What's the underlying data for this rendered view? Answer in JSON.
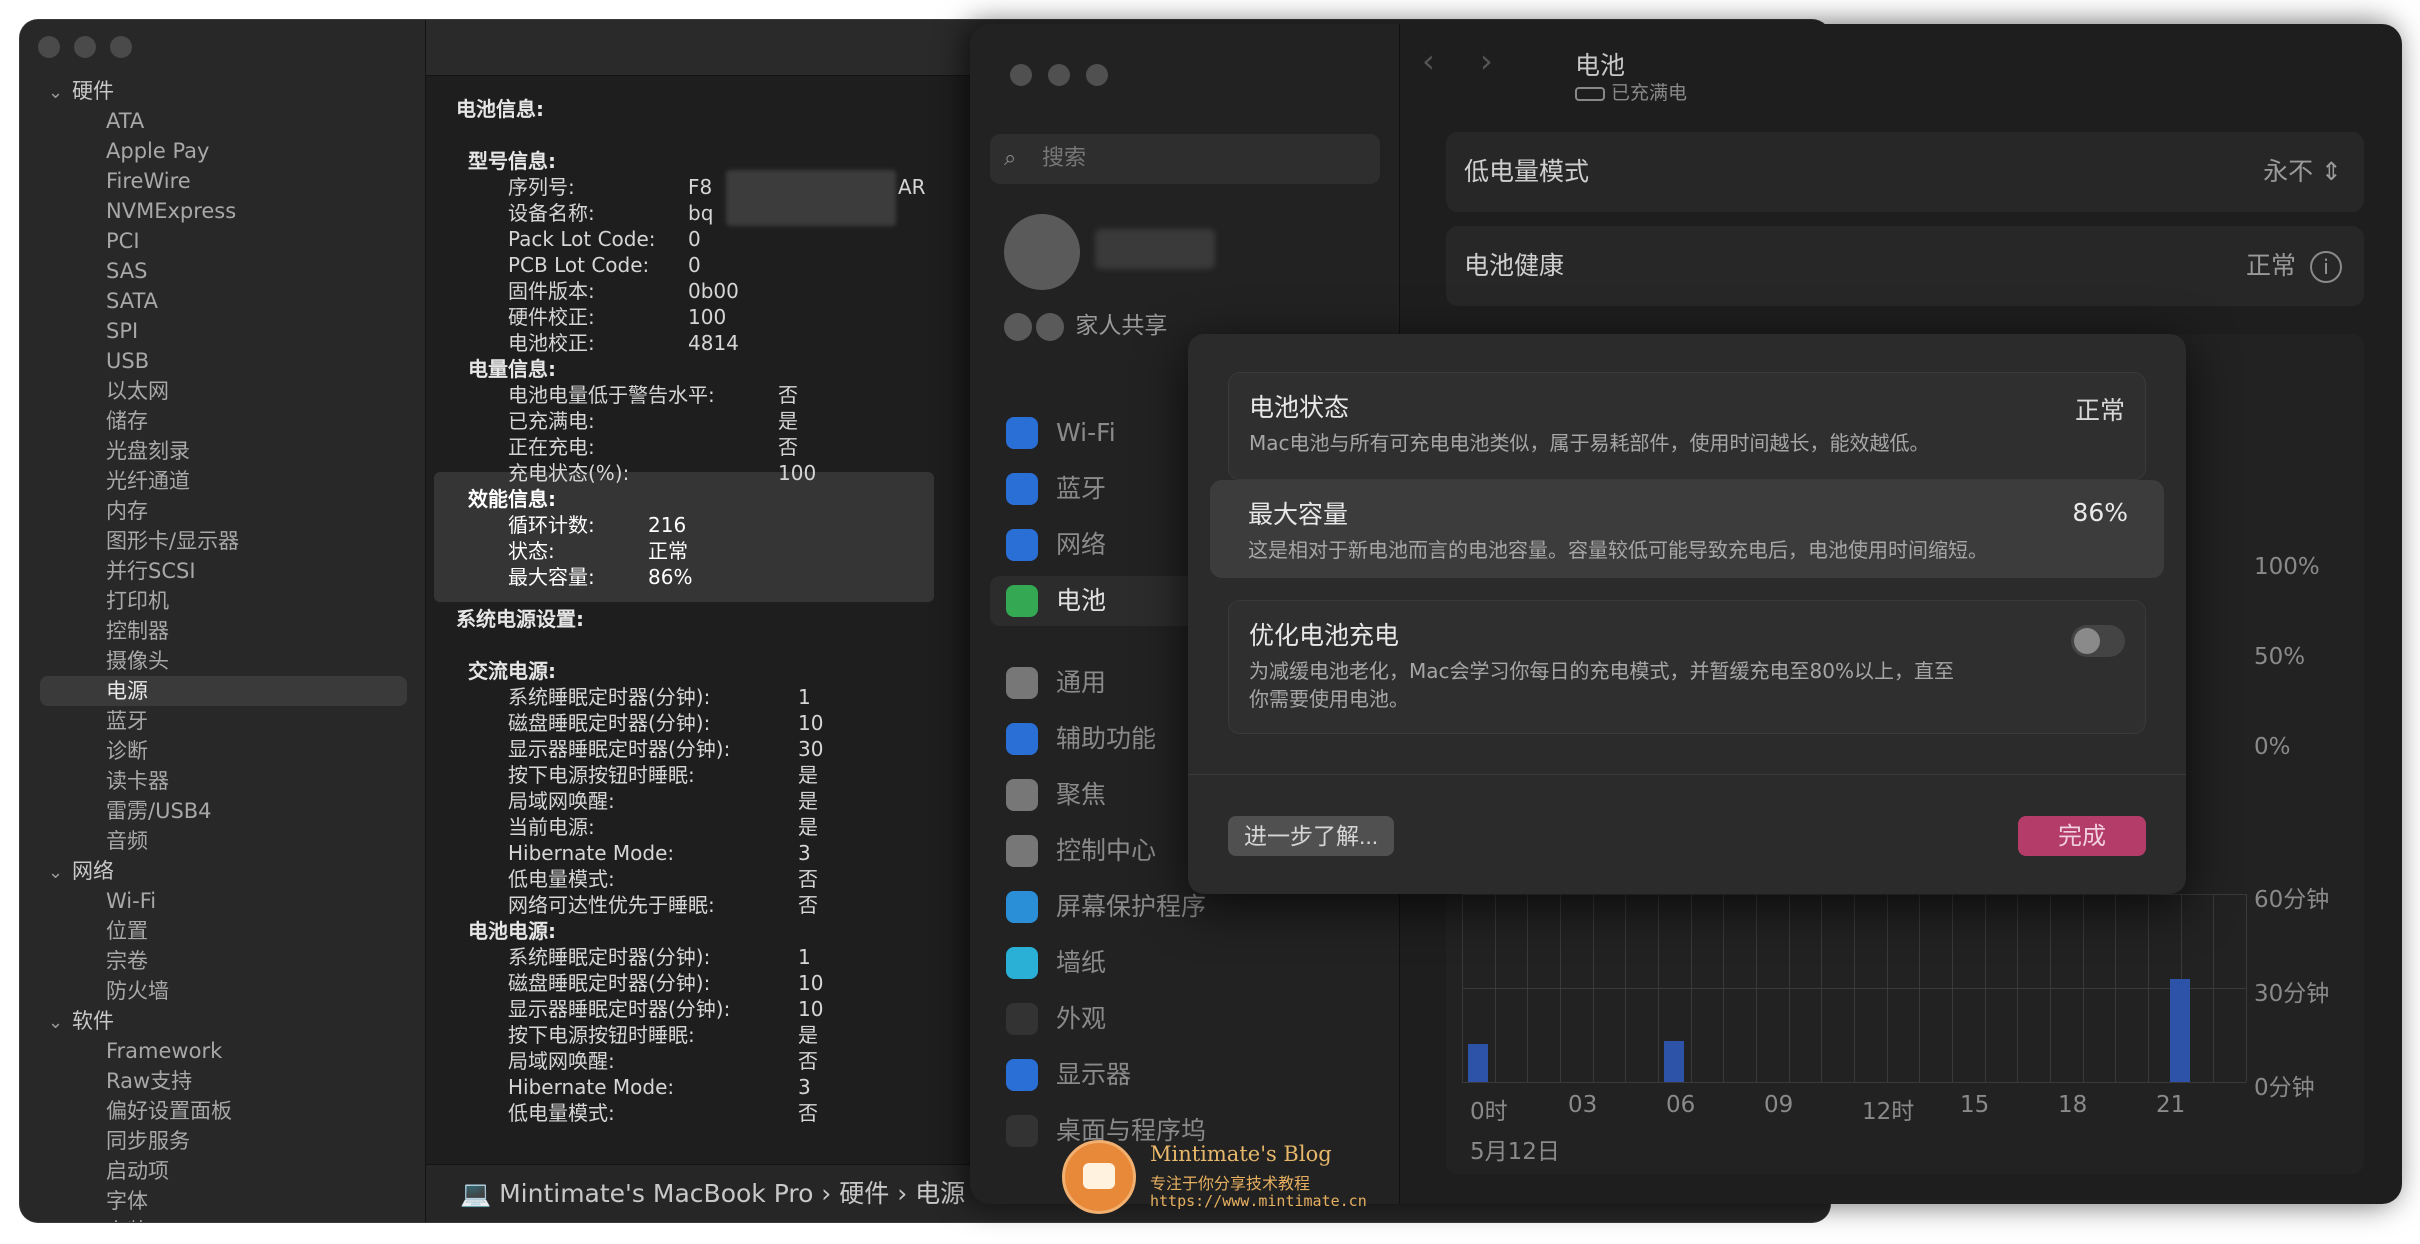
{
  "sysinfo": {
    "sidebar": [
      {
        "type": "section",
        "label": "硬件"
      },
      {
        "type": "item",
        "label": "ATA"
      },
      {
        "type": "item",
        "label": "Apple Pay"
      },
      {
        "type": "item",
        "label": "FireWire"
      },
      {
        "type": "item",
        "label": "NVMExpress"
      },
      {
        "type": "item",
        "label": "PCI"
      },
      {
        "type": "item",
        "label": "SAS"
      },
      {
        "type": "item",
        "label": "SATA"
      },
      {
        "type": "item",
        "label": "SPI"
      },
      {
        "type": "item",
        "label": "USB"
      },
      {
        "type": "item",
        "label": "以太网"
      },
      {
        "type": "item",
        "label": "储存"
      },
      {
        "type": "item",
        "label": "光盘刻录"
      },
      {
        "type": "item",
        "label": "光纤通道"
      },
      {
        "type": "item",
        "label": "内存"
      },
      {
        "type": "item",
        "label": "图形卡/显示器"
      },
      {
        "type": "item",
        "label": "并行SCSI"
      },
      {
        "type": "item",
        "label": "打印机"
      },
      {
        "type": "item",
        "label": "控制器"
      },
      {
        "type": "item",
        "label": "摄像头"
      },
      {
        "type": "item",
        "label": "电源",
        "selected": true
      },
      {
        "type": "item",
        "label": "蓝牙"
      },
      {
        "type": "item",
        "label": "诊断"
      },
      {
        "type": "item",
        "label": "读卡器"
      },
      {
        "type": "item",
        "label": "雷雳/USB4"
      },
      {
        "type": "item",
        "label": "音频"
      },
      {
        "type": "section",
        "label": "网络"
      },
      {
        "type": "item",
        "label": "Wi-Fi"
      },
      {
        "type": "item",
        "label": "位置"
      },
      {
        "type": "item",
        "label": "宗卷"
      },
      {
        "type": "item",
        "label": "防火墙"
      },
      {
        "type": "section",
        "label": "软件"
      },
      {
        "type": "item",
        "label": "Framework"
      },
      {
        "type": "item",
        "label": "Raw支持"
      },
      {
        "type": "item",
        "label": "偏好设置面板"
      },
      {
        "type": "item",
        "label": "同步服务"
      },
      {
        "type": "item",
        "label": "启动项"
      },
      {
        "type": "item",
        "label": "字体"
      },
      {
        "type": "item",
        "label": "安装"
      }
    ],
    "detail": {
      "battery_title": "电池信息:",
      "model_hdr": "型号信息:",
      "model": [
        {
          "k": "序列号:",
          "v": "F8",
          "v2": "AR"
        },
        {
          "k": "设备名称:",
          "v": "bq"
        },
        {
          "k": "Pack Lot Code:",
          "v": "0"
        },
        {
          "k": "PCB Lot Code:",
          "v": "0"
        },
        {
          "k": "固件版本:",
          "v": "0b00"
        },
        {
          "k": "硬件校正:",
          "v": "100"
        },
        {
          "k": "电池校正:",
          "v": "4814"
        }
      ],
      "charge_hdr": "电量信息:",
      "charge": [
        {
          "k": "电池电量低于警告水平:",
          "v": "否"
        },
        {
          "k": "已充满电:",
          "v": "是"
        },
        {
          "k": "正在充电:",
          "v": "否"
        },
        {
          "k": "充电状态(%):",
          "v": "100"
        }
      ],
      "perf_hdr": "效能信息:",
      "perf": [
        {
          "k": "循环计数:",
          "v": "216"
        },
        {
          "k": "状态:",
          "v": "正常"
        },
        {
          "k": "最大容量:",
          "v": "86%"
        }
      ],
      "power_title": "系统电源设置:",
      "ac_hdr": "交流电源:",
      "ac": [
        {
          "k": "系统睡眠定时器(分钟):",
          "v": "1"
        },
        {
          "k": "磁盘睡眠定时器(分钟):",
          "v": "10"
        },
        {
          "k": "显示器睡眠定时器(分钟):",
          "v": "30"
        },
        {
          "k": "按下电源按钮时睡眠:",
          "v": "是"
        },
        {
          "k": "局域网唤醒:",
          "v": "是"
        },
        {
          "k": "当前电源:",
          "v": "是"
        },
        {
          "k": "Hibernate Mode:",
          "v": "3"
        },
        {
          "k": "低电量模式:",
          "v": "否"
        },
        {
          "k": "网络可达性优先于睡眠:",
          "v": "否"
        }
      ],
      "batt_hdr": "电池电源:",
      "batt": [
        {
          "k": "系统睡眠定时器(分钟):",
          "v": "1"
        },
        {
          "k": "磁盘睡眠定时器(分钟):",
          "v": "10"
        },
        {
          "k": "显示器睡眠定时器(分钟):",
          "v": "10"
        },
        {
          "k": "按下电源按钮时睡眠:",
          "v": "是"
        },
        {
          "k": "局域网唤醒:",
          "v": "否"
        },
        {
          "k": "Hibernate Mode:",
          "v": "3"
        },
        {
          "k": "低电量模式:",
          "v": "否"
        }
      ]
    },
    "path": "Mintimate's MacBook Pro  ›  硬件  ›  电源"
  },
  "settings": {
    "search_placeholder": "搜索",
    "family": "家人共享",
    "nav": [
      "Wi-Fi",
      "蓝牙",
      "网络",
      "电池",
      "通用",
      "辅助功能",
      "聚焦",
      "控制中心",
      "屏幕保护程序",
      "墙纸",
      "外观",
      "显示器",
      "桌面与程序坞"
    ],
    "nav_selected_index": 3,
    "nav_icon_colors": [
      "#2a6fd6",
      "#2a6fd6",
      "#2a6fd6",
      "#34a853",
      "#777777",
      "#2a6fd6",
      "#777777",
      "#777777",
      "#2a8fd6",
      "#2ab0d6",
      "#333333",
      "#2a6fd6",
      "#333333"
    ],
    "title": "电池",
    "subtitle": "已充满电",
    "low_power_label": "低电量模式",
    "low_power_value": "永不",
    "health_label": "电池健康",
    "health_value": "正常",
    "chart_top": {
      "y_ticks": [
        "100%",
        "50%",
        "0%"
      ]
    },
    "chart_bottom": {
      "y_ticks": [
        "60分钟",
        "30分钟",
        "0分钟"
      ],
      "x_ticks": [
        "0时",
        "03",
        "06",
        "09",
        "12时",
        "15",
        "18",
        "21"
      ],
      "date": "5月12日",
      "bars": [
        {
          "hour": 0,
          "minutes": 12
        },
        {
          "hour": 6,
          "minutes": 13
        },
        {
          "hour": 21.5,
          "minutes": 33
        }
      ]
    }
  },
  "dialog": {
    "status_title": "电池状态",
    "status_value": "正常",
    "status_desc": "Mac电池与所有可充电电池类似，属于易耗部件，使用时间越长，能效越低。",
    "capacity_title": "最大容量",
    "capacity_value": "86%",
    "capacity_desc": "这是相对于新电池而言的电池容量。容量较低可能导致充电后，电池使用时间缩短。",
    "optimize_title": "优化电池充电",
    "optimize_desc1": "为减缓电池老化，Mac会学习你每日的充电模式，并暂缓充电至80%以上，直至",
    "optimize_desc2": "你需要使用电池。",
    "learn_label": "进一步了解...",
    "done_label": "完成"
  },
  "watermark": {
    "title": "Mintimate's Blog",
    "subtitle": "专注于你分享技术教程",
    "url": "https://www.mintimate.cn"
  }
}
